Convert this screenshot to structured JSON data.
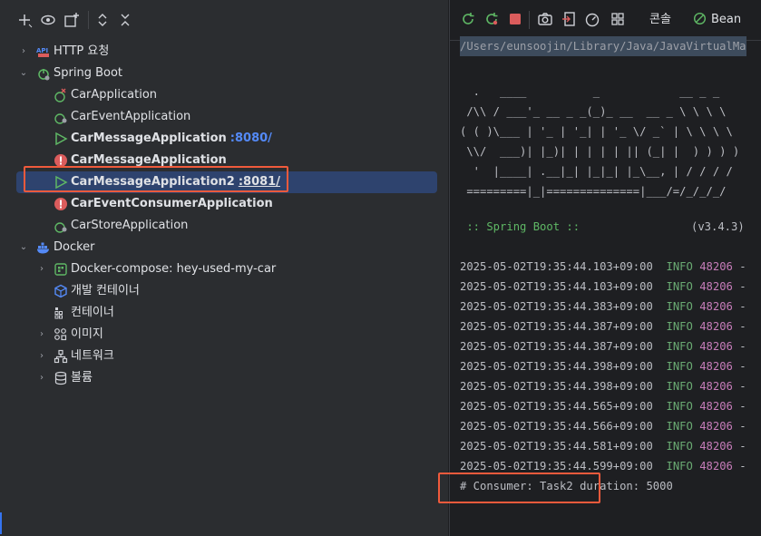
{
  "tree": {
    "items": [
      {
        "label": "HTTP 요청",
        "icon": "api-icon"
      },
      {
        "label": "Spring Boot",
        "icon": "spring-boot-icon"
      },
      {
        "label": "CarApplication",
        "icon": "spring-app-error-icon"
      },
      {
        "label": "CarEventApplication",
        "icon": "spring-app-icon"
      },
      {
        "label": "CarMessageApplication",
        "port": ":8080/",
        "icon": "run-icon"
      },
      {
        "label": "CarMessageApplication",
        "icon": "error-icon"
      },
      {
        "label": "CarMessageApplication2",
        "port": ":8081/",
        "icon": "run-icon"
      },
      {
        "label": "CarEventConsumerApplication",
        "icon": "error-icon"
      },
      {
        "label": "CarStoreApplication",
        "icon": "spring-app-icon"
      },
      {
        "label": "Docker",
        "icon": "docker-icon"
      },
      {
        "label": "Docker-compose: hey-used-my-car",
        "icon": "docker-compose-icon"
      },
      {
        "label": "개발 컨테이너",
        "icon": "dev-container-icon"
      },
      {
        "label": "컨테이너",
        "icon": "container-icon"
      },
      {
        "label": "이미지",
        "icon": "image-icon"
      },
      {
        "label": "네트워크",
        "icon": "network-icon"
      },
      {
        "label": "볼륨",
        "icon": "volume-icon"
      }
    ]
  },
  "right_tabs": {
    "console": "콘솔",
    "bean": "Bean"
  },
  "console": {
    "path": "/Users/eunsoojin/Library/Java/JavaVirtualMa",
    "banner": [
      "  .   ____          _            __ _ _",
      " /\\\\ / ___'_ __ _ _(_)_ __  __ _ \\ \\ \\ \\",
      "( ( )\\___ | '_ | '_| | '_ \\/ _` | \\ \\ \\ \\",
      " \\\\/  ___)| |_)| | | | | || (_| |  ) ) ) )",
      "  '  |____| .__|_| |_|_| |_\\__, | / / / /",
      " =========|_|==============|___/=/_/_/_/"
    ],
    "spring_boot_label": " :: Spring Boot ::",
    "spring_boot_version": "(v3.4.3)",
    "log_lines": [
      {
        "ts": "2025-05-02T19:35:44.103+09:00",
        "level": "INFO",
        "pid": "48206",
        "tail": "-"
      },
      {
        "ts": "2025-05-02T19:35:44.103+09:00",
        "level": "INFO",
        "pid": "48206",
        "tail": "-"
      },
      {
        "ts": "2025-05-02T19:35:44.383+09:00",
        "level": "INFO",
        "pid": "48206",
        "tail": "-"
      },
      {
        "ts": "2025-05-02T19:35:44.387+09:00",
        "level": "INFO",
        "pid": "48206",
        "tail": "-"
      },
      {
        "ts": "2025-05-02T19:35:44.387+09:00",
        "level": "INFO",
        "pid": "48206",
        "tail": "-"
      },
      {
        "ts": "2025-05-02T19:35:44.398+09:00",
        "level": "INFO",
        "pid": "48206",
        "tail": "-"
      },
      {
        "ts": "2025-05-02T19:35:44.398+09:00",
        "level": "INFO",
        "pid": "48206",
        "tail": "-"
      },
      {
        "ts": "2025-05-02T19:35:44.565+09:00",
        "level": "INFO",
        "pid": "48206",
        "tail": "-"
      },
      {
        "ts": "2025-05-02T19:35:44.566+09:00",
        "level": "INFO",
        "pid": "48206",
        "tail": "-"
      },
      {
        "ts": "2025-05-02T19:35:44.581+09:00",
        "level": "INFO",
        "pid": "48206",
        "tail": "-"
      },
      {
        "ts": "2025-05-02T19:35:44.599+09:00",
        "level": "INFO",
        "pid": "48206",
        "tail": "-"
      }
    ],
    "consumer_line": "# Consumer: Task2 duration: 5000"
  },
  "colors": {
    "accent": "#3574f0",
    "highlight": "#f05a3c",
    "spring_green": "#5fb865",
    "error_red": "#db5c5c",
    "port_blue": "#548af7"
  }
}
